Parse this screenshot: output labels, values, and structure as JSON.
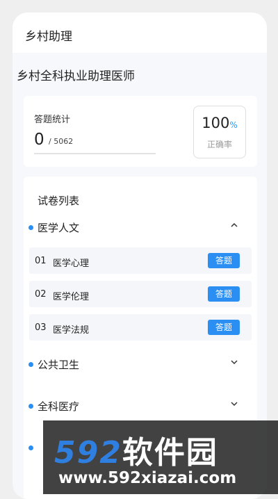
{
  "app": {
    "title": "乡村助理"
  },
  "subject_title": "乡村全科执业助理医师",
  "stats": {
    "label": "答题统计",
    "answered": "0",
    "total": "/ 5062",
    "accuracy_value": "100",
    "accuracy_unit": "%",
    "accuracy_label": "正确率"
  },
  "papers": {
    "heading": "试卷列表",
    "sections": [
      {
        "label": "医学人文",
        "expanded": true,
        "items": [
          {
            "num": "01",
            "name": "医学心理",
            "button": "答题"
          },
          {
            "num": "02",
            "name": "医学伦理",
            "button": "答题"
          },
          {
            "num": "03",
            "name": "医学法规",
            "button": "答题"
          }
        ]
      },
      {
        "label": "公共卫生",
        "expanded": false
      },
      {
        "label": "全科医疗",
        "expanded": false
      },
      {
        "label": "",
        "expanded": false
      }
    ]
  },
  "icons": {
    "expanded": "chevron-up-icon",
    "collapsed": "chevron-down-icon"
  },
  "colors": {
    "accent": "#2b8ef3"
  },
  "watermark": {
    "brand_digits": "592",
    "brand_cn": "软件园",
    "url": "www.592xiazai.com"
  }
}
